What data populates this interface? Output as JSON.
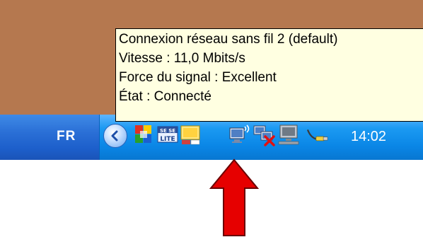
{
  "taskbar": {
    "language": "FR",
    "clock": "14:02",
    "tray_icons": [
      "chevron-left-icon",
      "hp-app-icon",
      "lite-app-icon",
      "monitor-app-icon",
      "wireless-network-icon",
      "disconnected-network-icon",
      "network-computer-icon",
      "usb-device-icon"
    ]
  },
  "tooltip": {
    "lines": [
      "Connexion réseau sans fil 2 (default)",
      "Vitesse : 11,0 Mbits/s",
      "Force du signal : Excellent",
      "État : Connecté"
    ]
  },
  "annotation": {
    "arrow_color": "#e00000"
  }
}
